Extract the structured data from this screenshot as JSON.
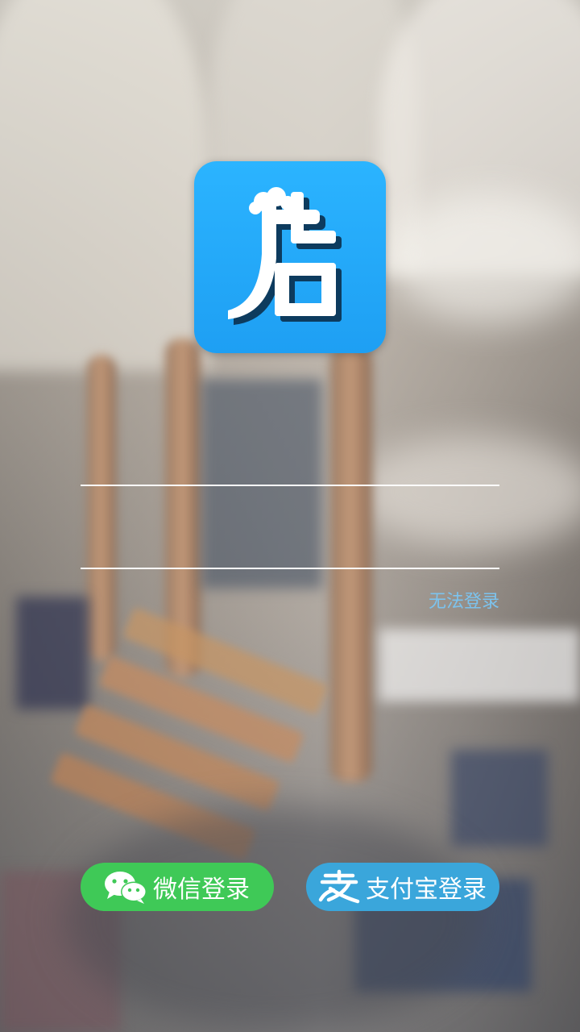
{
  "logo": {
    "glyph": "店",
    "color": "#1ea4f6"
  },
  "form": {
    "username": {
      "value": "",
      "placeholder": ""
    },
    "password": {
      "value": "",
      "placeholder": ""
    },
    "forgot_label": "无法登录"
  },
  "third_party": {
    "wechat": {
      "label": "微信登录",
      "color": "#3fc957",
      "icon": "wechat-icon"
    },
    "alipay": {
      "label": "支付宝登录",
      "color": "#3aa6db",
      "icon": "alipay-icon"
    }
  }
}
